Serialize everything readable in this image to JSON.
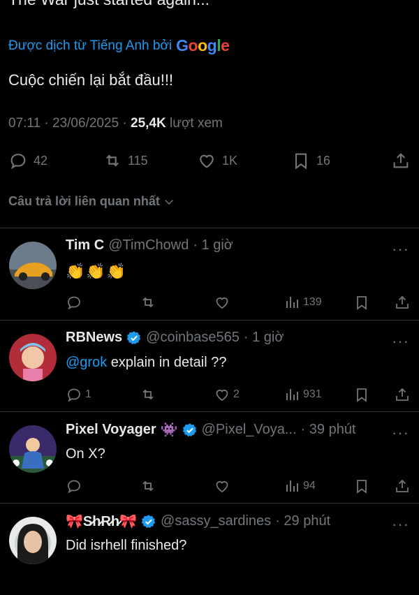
{
  "post": {
    "original_text_cut": "The War just started again...",
    "translated_label": "Được dịch từ Tiếng Anh bởi",
    "google": [
      "G",
      "o",
      "o",
      "g",
      "l",
      "e"
    ],
    "translated_text": "Cuộc chiến lại bắt đầu!!!",
    "time": "07:11 · 23/06/2025 ·",
    "views_count": "25,4K",
    "views_label": "lượt xem",
    "replies": "42",
    "reposts": "115",
    "likes": "1K",
    "bookmarks": "16"
  },
  "sort_label": "Câu trả lời liên quan nhất",
  "replies": [
    {
      "name": "Tim C",
      "handle": "@TimChowd",
      "time": "· 1 giờ",
      "text": "👏👏👏",
      "reply_count": "",
      "repost_count": "",
      "like_count": "",
      "views": "139"
    },
    {
      "name": "RBNews",
      "handle": "@coinbase565",
      "time": "· 1 giờ",
      "mention": "@grok",
      "text": " explain in detail ??",
      "reply_count": "1",
      "repost_count": "",
      "like_count": "2",
      "views": "931"
    },
    {
      "name": "Pixel Voyager",
      "emoji": "👾",
      "handle": "@Pixel_Voya...",
      "time": "· 39 phút",
      "text": "On X?",
      "reply_count": "",
      "repost_count": "",
      "like_count": "",
      "views": "94"
    },
    {
      "name": "🎀S̷h̷R̷h̷🎀",
      "handle": "@sassy_sardines",
      "time": "· 29 phút",
      "text": "Did isrhell finished?"
    }
  ],
  "more_label": "···",
  "colors": {
    "accent": "#1d9bf0",
    "muted": "#71767b",
    "bg": "#000000",
    "divider": "#2f3336"
  }
}
